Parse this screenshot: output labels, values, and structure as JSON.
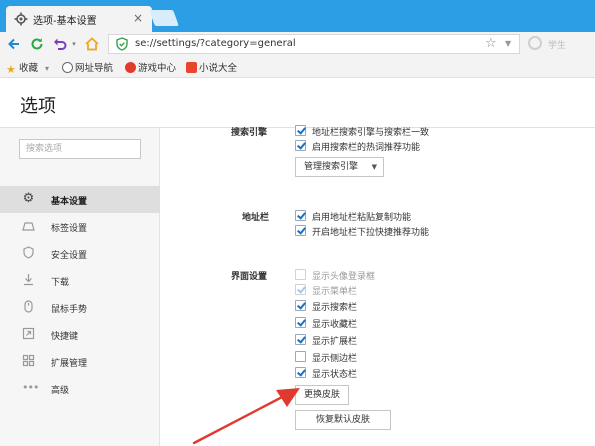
{
  "tab": {
    "title": "选项-基本设置",
    "close": "×"
  },
  "address": {
    "url": "se://settings/?category=general",
    "right_text": "学生"
  },
  "bookmarks": [
    {
      "label": "收藏",
      "caret": "▾"
    },
    {
      "label": "网址导航"
    },
    {
      "label": "游戏中心"
    },
    {
      "label": "小说大全"
    }
  ],
  "page": {
    "title": "选项"
  },
  "sidebar": {
    "search_placeholder": "搜索选项",
    "items": [
      {
        "label": "基本设置",
        "icon": "gear-icon",
        "active": true
      },
      {
        "label": "标签设置",
        "icon": "tab-icon"
      },
      {
        "label": "安全设置",
        "icon": "shield-icon"
      },
      {
        "label": "下载",
        "icon": "download-icon"
      },
      {
        "label": "鼠标手势",
        "icon": "mouse-icon"
      },
      {
        "label": "快捷键",
        "icon": "shortcut-icon"
      },
      {
        "label": "扩展管理",
        "icon": "grid-icon"
      },
      {
        "label": "高级",
        "icon": "dots-icon"
      }
    ]
  },
  "sections": {
    "search_engine": {
      "label": "搜索引擎",
      "options": [
        {
          "label": "地址栏搜索引擎与搜索栏一致",
          "checked": true
        },
        {
          "label": "启用搜索栏的热词推荐功能",
          "checked": true
        }
      ],
      "manage_button": "管理搜索引擎",
      "manage_caret": "▼"
    },
    "address_bar": {
      "label": "地址栏",
      "options": [
        {
          "label": "启用地址栏粘贴复制功能",
          "checked": true
        },
        {
          "label": "开启地址栏下拉快捷推荐功能",
          "checked": true
        }
      ]
    },
    "ui": {
      "label": "界面设置",
      "options": [
        {
          "label": "显示头像登录框",
          "checked": false,
          "disabled": true
        },
        {
          "label": "显示菜单栏",
          "checked": true,
          "disabled": true
        },
        {
          "label": "显示搜索栏",
          "checked": true
        },
        {
          "label": "显示收藏栏",
          "checked": true
        },
        {
          "label": "显示扩展栏",
          "checked": true
        },
        {
          "label": "显示侧边栏",
          "checked": false
        },
        {
          "label": "显示状态栏",
          "checked": true
        }
      ],
      "change_skin_button": "更换皮肤",
      "restore_skin_button": "恢复默认皮肤"
    }
  },
  "colors": {
    "tabstrip": "#2c9ee6",
    "annotation_arrow": "#e03a2f"
  }
}
